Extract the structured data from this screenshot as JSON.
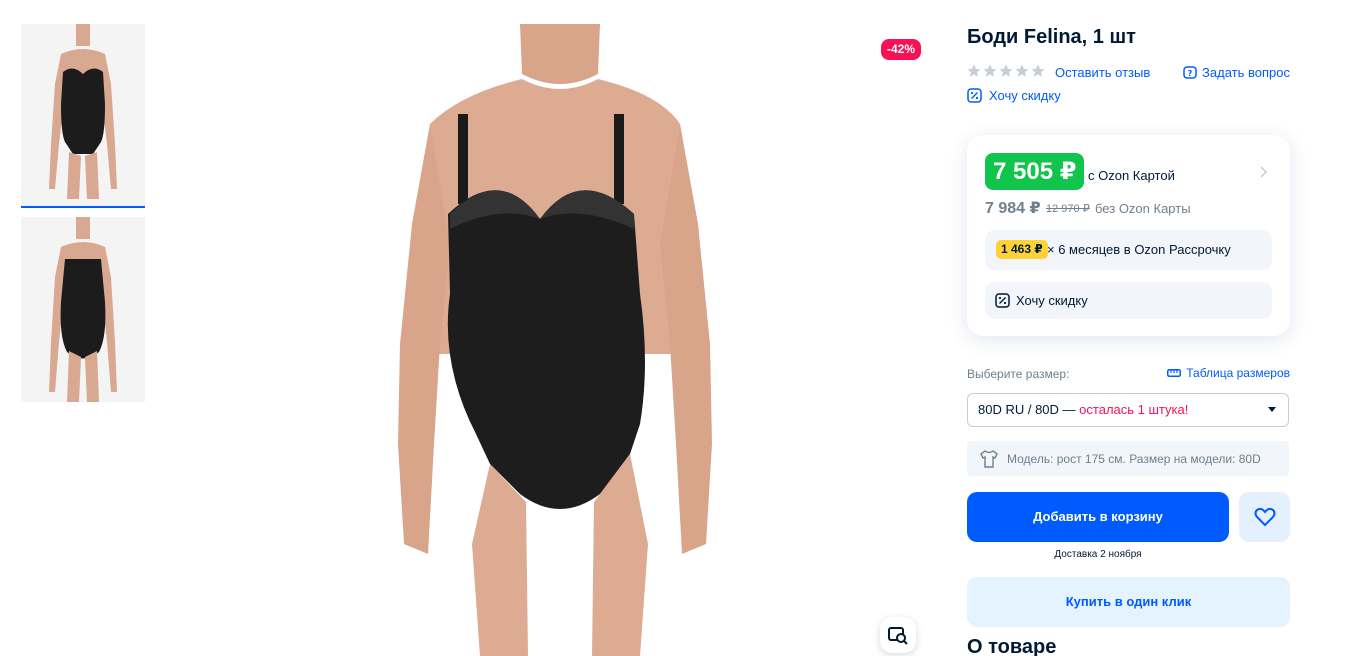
{
  "product": {
    "title": "Боди Felina, 1 шт",
    "discount_badge": "-42%",
    "rating_stars": 0,
    "leave_review": "Оставить отзыв",
    "ask_question": "Задать вопрос",
    "want_discount": "Хочу скидку"
  },
  "price": {
    "with_card": "7 505 ₽",
    "with_card_label": "с Ozon Картой",
    "without_card": "7 984 ₽",
    "old_price": "12 970 ₽",
    "without_card_label": "без Ozon Карты",
    "installment_amount": "1 463 ₽",
    "installment_text": "× 6 месяцев в Ozon Рассрочку",
    "want_discount": "Хочу скидку"
  },
  "size": {
    "label": "Выберите размер:",
    "table_link": "Таблица размеров",
    "selected": "80D RU / 80D —",
    "stock_note": "осталась 1 штука!",
    "model_info": "Модель: рост 175 см. Размер на модели: 80D"
  },
  "actions": {
    "add_to_cart": "Добавить в корзину",
    "delivery": "Доставка 2 ноября",
    "buy_one_click": "Купить в один клик"
  },
  "section": {
    "about": "О товаре"
  },
  "colors": {
    "accent": "#005bff",
    "price_green": "#10c44c",
    "discount_red": "#f91155",
    "installment_yellow": "#ffd338"
  }
}
